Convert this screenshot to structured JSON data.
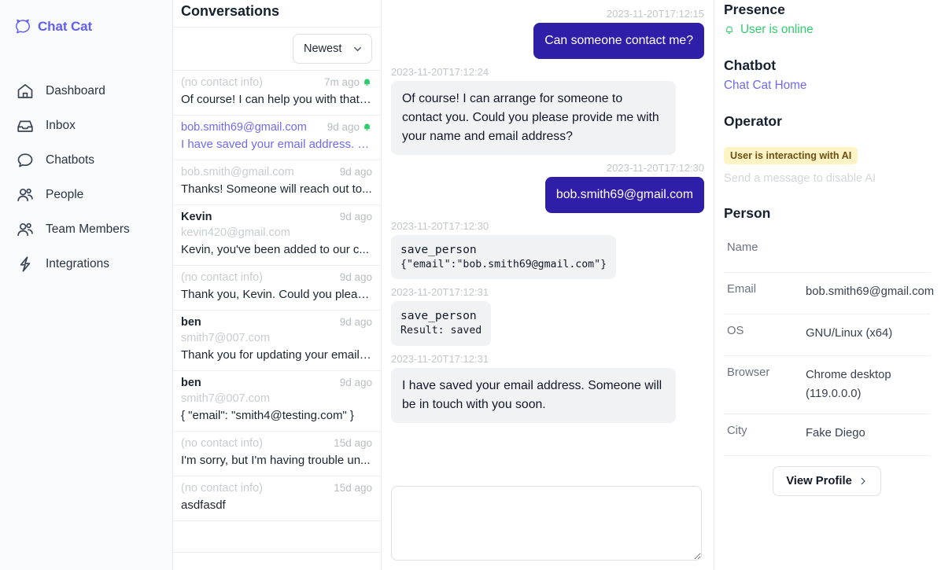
{
  "brand": {
    "name": "Chat Cat",
    "logo_icon": "cat-speech-bubble-icon"
  },
  "sidebar": {
    "items": [
      {
        "label": "Dashboard",
        "icon": "home-icon"
      },
      {
        "label": "Inbox",
        "icon": "inbox-icon"
      },
      {
        "label": "Chatbots",
        "icon": "chat-bubble-icon"
      },
      {
        "label": "People",
        "icon": "people-icon"
      },
      {
        "label": "Team Members",
        "icon": "people-icon"
      },
      {
        "label": "Integrations",
        "icon": "lightning-bolt-icon"
      }
    ]
  },
  "conversations": {
    "title": "Conversations",
    "sort": {
      "value": "Newest",
      "icon": "chevron-down-icon"
    },
    "items": [
      {
        "who": "(no contact info)",
        "who_style": "muted",
        "time": "7m ago",
        "bell": true,
        "snippet": "Of course! I can help you with that....",
        "selected": false
      },
      {
        "who": "bob.smith69@gmail.com",
        "who_style": "selected",
        "time": "9d ago",
        "bell": true,
        "snippet": "I have saved your email address. S...",
        "selected": true
      },
      {
        "who": "bob.smith@gmail.com",
        "who_style": "muted",
        "time": "9d ago",
        "bell": false,
        "snippet": "Thanks! Someone will reach out to...",
        "selected": false
      },
      {
        "who": "Kevin",
        "who_style": "named",
        "sub": "kevin420@gmail.com",
        "time": "9d ago",
        "bell": false,
        "snippet": "Kevin, you've been added to our c...",
        "selected": false
      },
      {
        "who": "(no contact info)",
        "who_style": "muted",
        "time": "9d ago",
        "bell": false,
        "snippet": "Thank you, Kevin. Could you pleas...",
        "selected": false
      },
      {
        "who": "ben",
        "who_style": "named",
        "sub": "smith7@007.com",
        "time": "9d ago",
        "bell": false,
        "snippet": "Thank you for updating your email,...",
        "selected": false
      },
      {
        "who": "ben",
        "who_style": "named",
        "sub": "smith7@007.com",
        "time": "9d ago",
        "bell": false,
        "snippet": "{ \"email\": \"smith4@testing.com\" }",
        "selected": false
      },
      {
        "who": "(no contact info)",
        "who_style": "muted",
        "time": "15d ago",
        "bell": false,
        "snippet": "I'm sorry, but I'm having trouble un...",
        "selected": false
      },
      {
        "who": "(no contact info)",
        "who_style": "muted",
        "time": "15d ago",
        "bell": false,
        "snippet": "asdfasdf",
        "selected": false
      }
    ]
  },
  "chat": {
    "messages": [
      {
        "type": "text",
        "dir": "out",
        "ts": "2023-11-20T17:12:15",
        "text": "Can someone contact me?"
      },
      {
        "type": "text",
        "dir": "in",
        "ts": "2023-11-20T17:12:24",
        "text": "Of course! I can arrange for someone to contact you. Could you please provide me with your name and email address?"
      },
      {
        "type": "text",
        "dir": "out",
        "ts": "2023-11-20T17:12:30",
        "text": "bob.smith69@gmail.com"
      },
      {
        "type": "tool",
        "dir": "in",
        "ts": "2023-11-20T17:12:30",
        "tool_name": "save_person",
        "tool_detail": "{\"email\":\"bob.smith69@gmail.com\"}"
      },
      {
        "type": "tool",
        "dir": "in",
        "ts": "2023-11-20T17:12:31",
        "tool_name": "save_person",
        "tool_detail": "Result: saved"
      },
      {
        "type": "text",
        "dir": "in",
        "ts": "2023-11-20T17:12:31",
        "text": "I have saved your email address. Someone will be in touch with you soon."
      }
    ],
    "composer": {
      "value": "",
      "placeholder": ""
    }
  },
  "details": {
    "presence": {
      "title": "Presence",
      "status": "User is online",
      "icon": "bell-icon"
    },
    "chatbot": {
      "title": "Chatbot",
      "link": "Chat Cat Home"
    },
    "operator": {
      "title": "Operator",
      "badge": "User is interacting with AI",
      "hint": "Send a message to disable AI"
    },
    "person": {
      "title": "Person",
      "rows": [
        {
          "key": "Name",
          "value": ""
        },
        {
          "key": "Email",
          "value": "bob.smith69@gmail.com"
        },
        {
          "key": "OS",
          "value": "GNU/Linux (x64)"
        },
        {
          "key": "Browser",
          "value": "Chrome desktop (119.0.0.0)"
        },
        {
          "key": "City",
          "value": "Fake Diego"
        }
      ],
      "profile_button": {
        "label": "View Profile",
        "icon": "chevron-right-icon"
      }
    }
  },
  "colors": {
    "brand_purple": "#625df5",
    "selected_purple": "#6f6af0",
    "outgoing_bubble": "#2f1fa8",
    "incoming_bubble": "#f1f2f4",
    "online_green": "#2fcc6d",
    "badge_yellow": "#fdf3c4",
    "badge_text": "#6b4f13"
  }
}
